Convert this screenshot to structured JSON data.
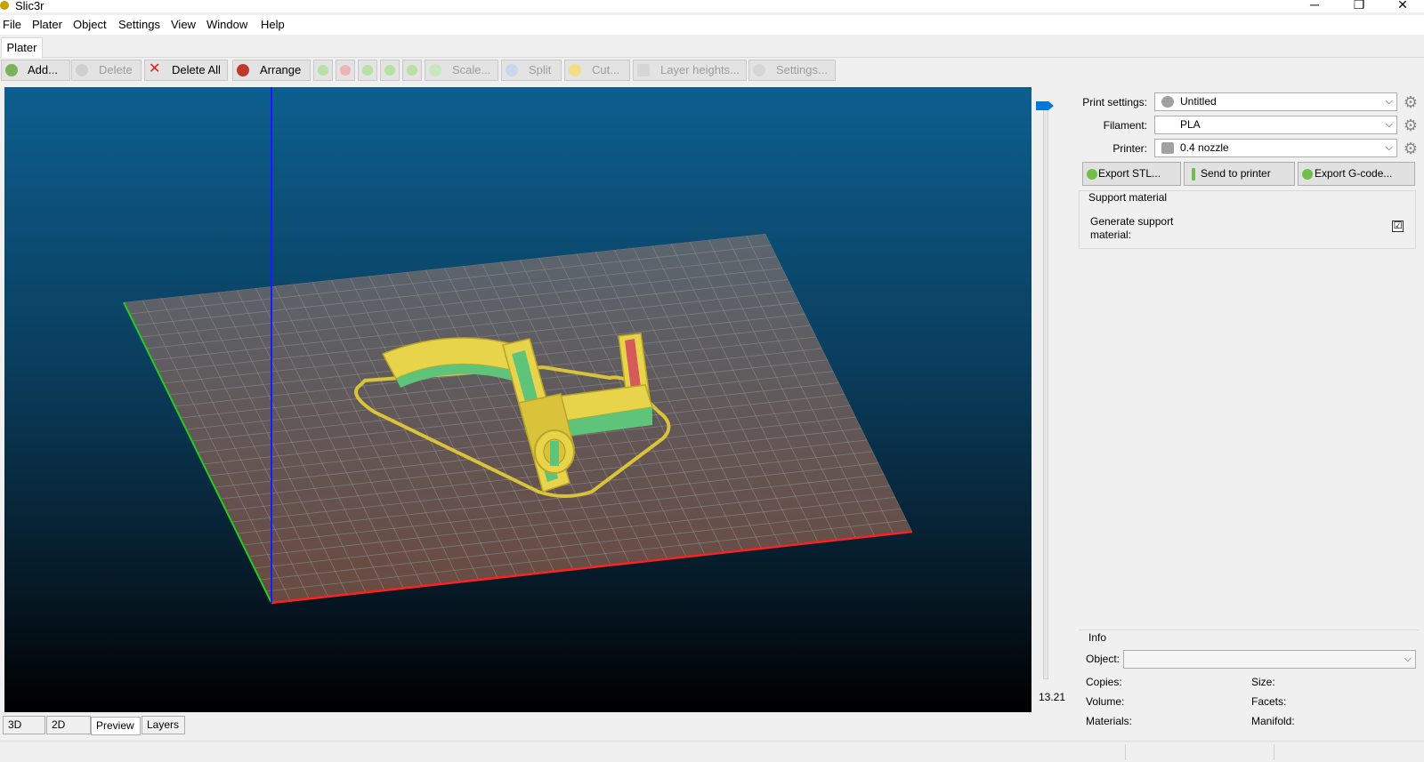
{
  "window": {
    "title": "Slic3r",
    "minimize": "─",
    "restore": "❐",
    "close": "✕"
  },
  "menu": [
    "File",
    "Plater",
    "Object",
    "Settings",
    "View",
    "Window",
    "Help"
  ],
  "tabs": {
    "plater": "Plater"
  },
  "toolbar": {
    "add": "Add...",
    "delete": "Delete",
    "delete_all": "Delete All",
    "arrange": "Arrange",
    "scale": "Scale...",
    "split": "Split",
    "cut": "Cut...",
    "layer_heights": "Layer heights...",
    "settings": "Settings..."
  },
  "preview": {
    "layer_value": "13.21",
    "layer_position": 1.0,
    "colors": {
      "bed": "#5f5f5f",
      "model": "#e8d44a",
      "support": "#5ec47a",
      "x_axis": "#ff2020",
      "y_axis": "#22cc22",
      "z_axis": "#1a1aff"
    }
  },
  "sidebar": {
    "print_settings_label": "Print settings:",
    "print_settings_value": "Untitled",
    "filament_label": "Filament:",
    "filament_value": "PLA",
    "printer_label": "Printer:",
    "printer_value": "0.4 nozzle",
    "export_stl": "Export STL...",
    "send_to_printer": "Send to printer",
    "export_gcode": "Export G-code...",
    "support_group": "Support material",
    "generate_support_label": "Generate support material:",
    "generate_support_checked": "☑"
  },
  "info": {
    "title": "Info",
    "object_label": "Object:",
    "object_value": "",
    "copies": "Copies:",
    "size": "Size:",
    "volume": "Volume:",
    "facets": "Facets:",
    "materials": "Materials:",
    "manifold": "Manifold:"
  },
  "view_tabs": [
    "3D",
    "2D",
    "Preview",
    "Layers"
  ]
}
